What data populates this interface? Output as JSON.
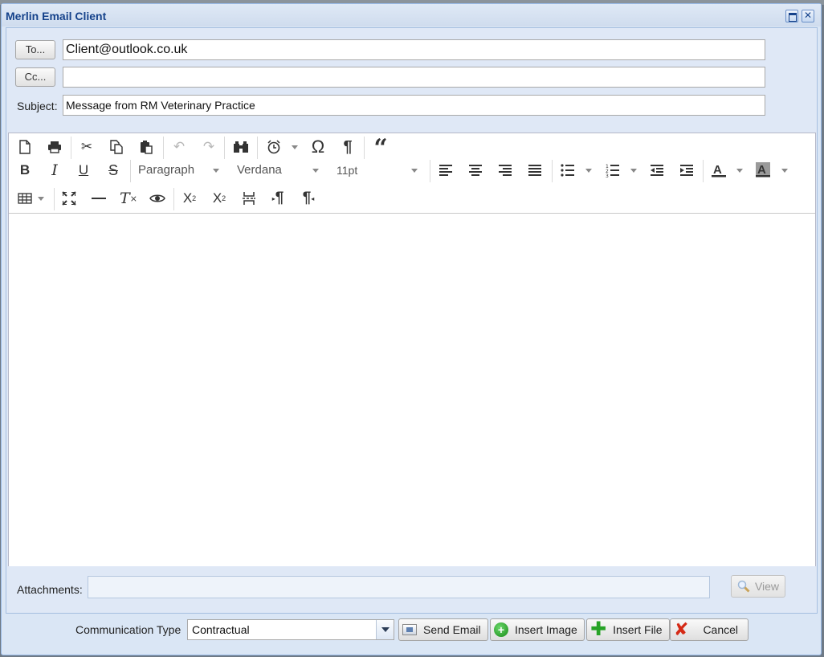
{
  "window": {
    "title": "Merlin Email Client"
  },
  "fields": {
    "to_button": "To...",
    "to_value": "Client@outlook.co.uk",
    "cc_button": "Cc...",
    "cc_value": "",
    "subject_label": "Subject:",
    "subject_value": "Message from RM Veterinary Practice"
  },
  "toolbar": {
    "paragraph_combo": "Paragraph",
    "font_combo": "Verdana",
    "size_combo": "11pt",
    "icons_row1": [
      "new-document",
      "print",
      "cut",
      "copy",
      "paste",
      "undo",
      "redo",
      "find",
      "insert-time",
      "special-character",
      "show-blocks",
      "blockquote"
    ],
    "icons_row2": [
      "bold",
      "italic",
      "underline",
      "strikethrough",
      "align-left",
      "align-center",
      "align-right",
      "justify",
      "bullet-list",
      "numbered-list",
      "outdent",
      "indent",
      "text-color",
      "background-color"
    ],
    "icons_row3": [
      "table",
      "fullscreen",
      "horizontal-rule",
      "clear-formatting",
      "preview",
      "subscript",
      "superscript",
      "page-break",
      "ltr",
      "rtl"
    ]
  },
  "attachments": {
    "label": "Attachments:",
    "view_button": "View"
  },
  "footer": {
    "comm_type_label": "Communication Type",
    "comm_type_value": "Contractual",
    "send_button": "Send Email",
    "insert_image_button": "Insert Image",
    "insert_file_button": "Insert File",
    "cancel_button": "Cancel"
  }
}
